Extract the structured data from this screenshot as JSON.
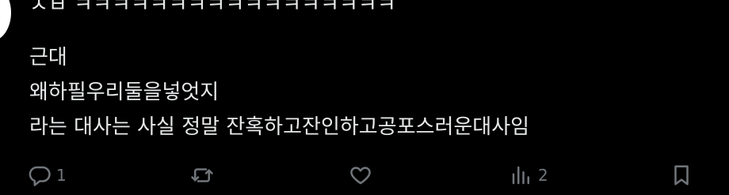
{
  "post": {
    "lines": [
      "ㅅㅂ ㅋㅋㅋㅋㅋㅋㅋㅋㅋㅋㅋㅋㅋㅋㅋㅋㅋ",
      "근대",
      "왜하필우리둘을넣엇지",
      "라는 대사는 사실 정말 잔혹하고잔인하고공포스러운대사임"
    ]
  },
  "actions": {
    "reply": {
      "icon": "reply-icon",
      "count": "1"
    },
    "repost": {
      "icon": "repost-icon",
      "count": ""
    },
    "like": {
      "icon": "heart-icon",
      "count": ""
    },
    "views": {
      "icon": "views-icon",
      "count": "2"
    },
    "bookmark": {
      "icon": "bookmark-icon",
      "count": ""
    }
  },
  "colors": {
    "background": "#000000",
    "text": "#e7e9ea",
    "icon": "#71767b",
    "avatar": "#ffffff"
  }
}
